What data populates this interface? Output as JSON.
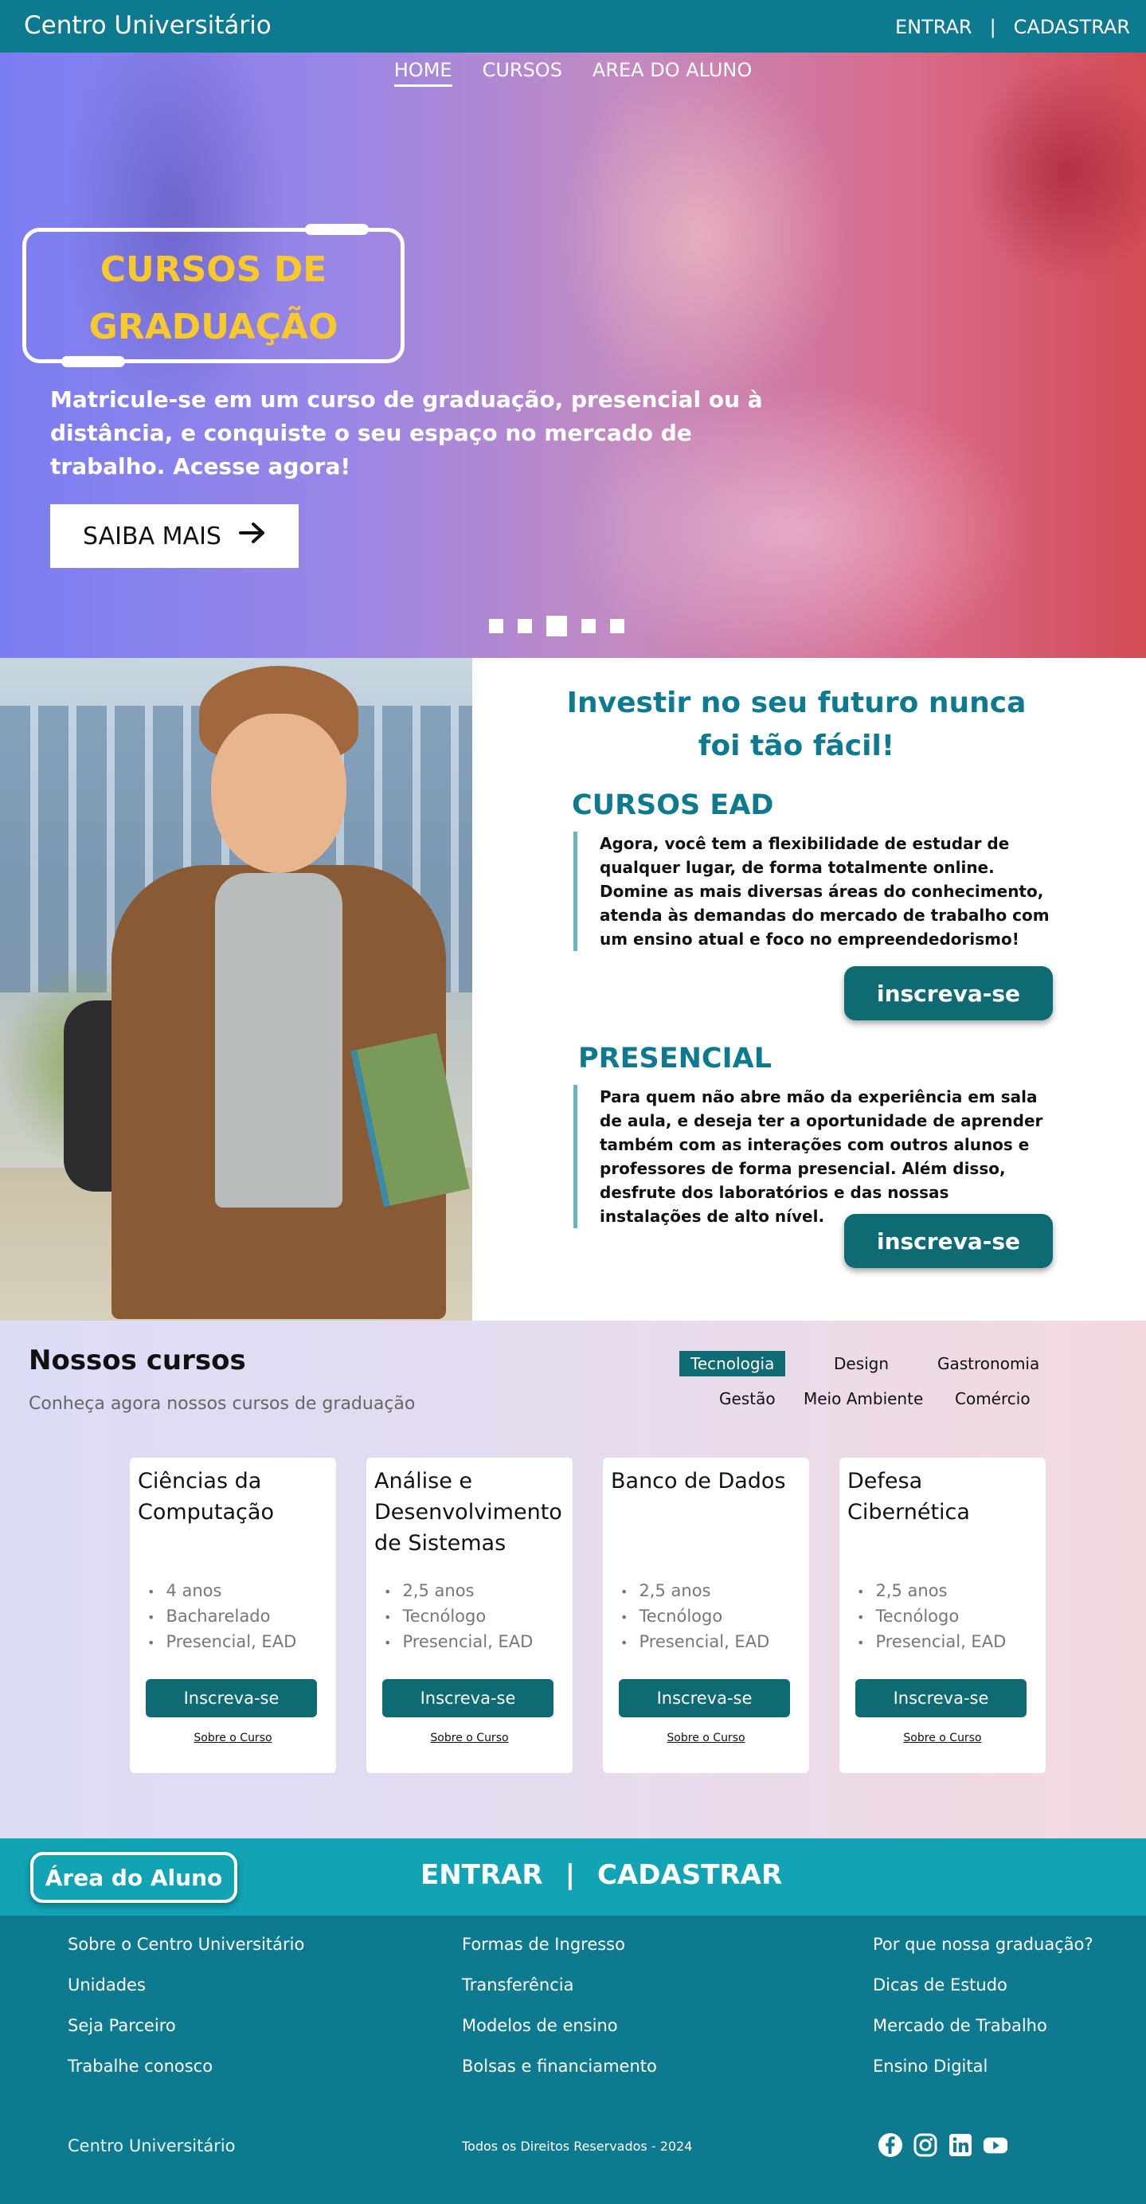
{
  "topbar": {
    "brand": "Centro Universitário",
    "login": "ENTRAR",
    "sep": "|",
    "signup": "CADASTRAR"
  },
  "hero": {
    "nav": [
      "HOME",
      "CURSOS",
      "AREA DO ALUNO"
    ],
    "title_line1": "CURSOS DE",
    "title_line2": "GRADUAÇÃO",
    "description": "Matricule-se em um curso de graduação, presencial ou à distância,  e conquiste o seu espaço no mercado de trabalho. Acesse agora!",
    "cta": "SAIBA MAIS",
    "slides": 5,
    "active_slide": 3
  },
  "invest": {
    "title": "Investir no seu futuro nunca foi tão fácil!",
    "ead": {
      "heading": "CURSOS EAD",
      "text": "Agora, você tem a flexibilidade de estudar de qualquer lugar, de forma totalmente online. Domine as mais diversas áreas do conhecimento, atenda às demandas do mercado de trabalho com um ensino atual e foco no empreendedorismo!",
      "button": "inscreva-se"
    },
    "presencial": {
      "heading": "PRESENCIAL",
      "text": "Para quem não abre mão da experiência em sala de aula, e deseja ter a oportunidade de aprender também com as interações com outros alunos e professores de forma presencial. Além disso, desfrute dos laboratórios e das nossas instalações de alto nível.",
      "button": "inscreva-se"
    }
  },
  "courses": {
    "title": "Nossos cursos",
    "subtitle": "Conheça agora nossos cursos de graduação",
    "filters": [
      "Tecnologia",
      "Design",
      "Gastronomia",
      "Gestão",
      "Meio Ambiente",
      "Comércio"
    ],
    "active_filter": "Tecnologia",
    "cards": [
      {
        "name": "Ciências da Computação",
        "details": [
          "4 anos",
          "Bacharelado",
          "Presencial, EAD"
        ],
        "button": "Inscreva-se",
        "link": "Sobre o Curso"
      },
      {
        "name": "Análise e Desenvolvimento de Sistemas",
        "details": [
          "2,5 anos",
          "Tecnólogo",
          "Presencial, EAD"
        ],
        "button": "Inscreva-se",
        "link": "Sobre o Curso"
      },
      {
        "name": "Banco de Dados",
        "details": [
          "2,5 anos",
          "Tecnólogo",
          "Presencial, EAD"
        ],
        "button": "Inscreva-se",
        "link": "Sobre o Curso"
      },
      {
        "name": "Defesa Cibernética",
        "details": [
          "2,5 anos",
          "Tecnólogo",
          "Presencial, EAD"
        ],
        "button": "Inscreva-se",
        "link": "Sobre o Curso"
      }
    ]
  },
  "student_bar": {
    "area": "Área do Aluno",
    "login": "ENTRAR",
    "sep": "|",
    "signup": "CADASTRAR"
  },
  "footer": {
    "col1": [
      "Sobre o Centro Universitário",
      "Unidades",
      "Seja Parceiro",
      "Trabalhe conosco"
    ],
    "col2": [
      "Formas de Ingresso",
      "Transferência",
      "Modelos de ensino",
      "Bolsas e financiamento"
    ],
    "col3": [
      "Por que nossa graduação?",
      "Dicas de Estudo",
      "Mercado de Trabalho",
      "Ensino Digital"
    ],
    "brand": "Centro Universitário",
    "rights": "Todos os Direitos Reservados - 2024",
    "social": [
      "facebook-icon",
      "instagram-icon",
      "linkedin-icon",
      "youtube-icon"
    ]
  },
  "colors": {
    "primary": "#0e7a8f",
    "button": "#0f6b73",
    "accent": "#f7c92b",
    "student_bar": "#12a3b5"
  }
}
